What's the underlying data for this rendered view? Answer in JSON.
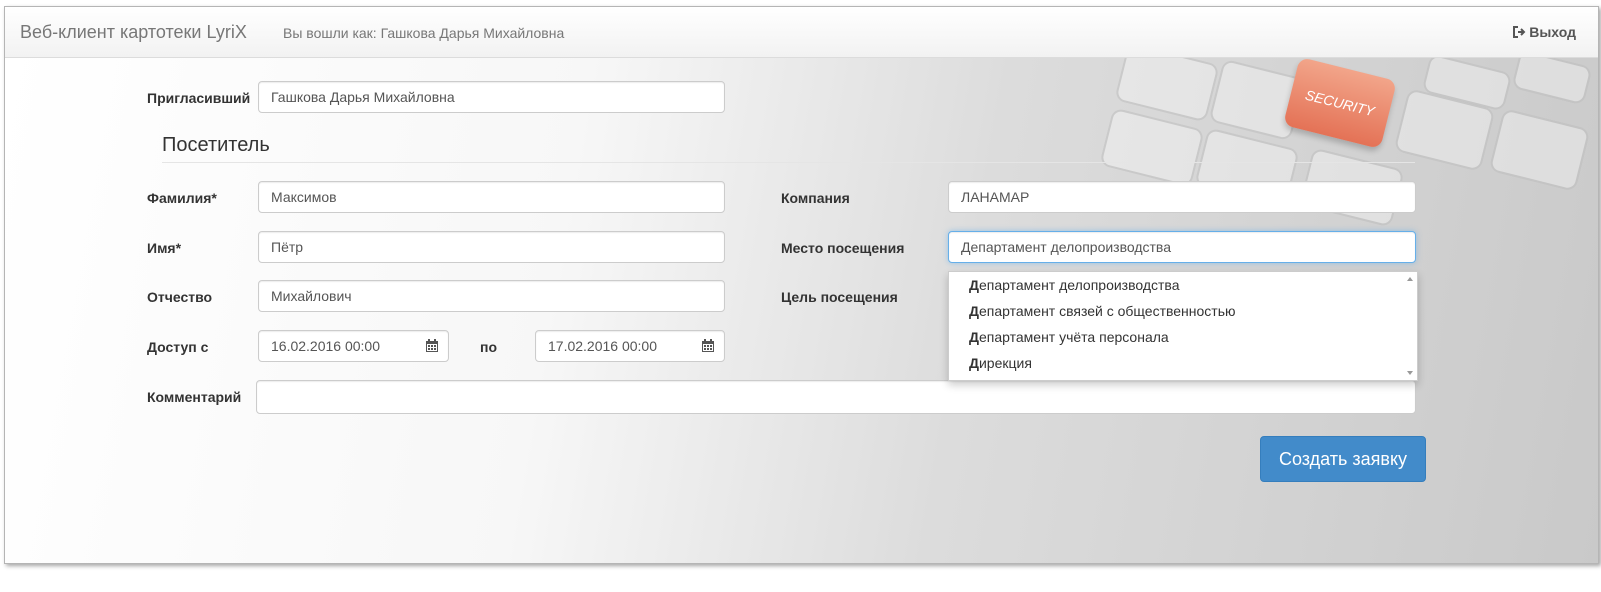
{
  "header": {
    "brand": "Веб-клиент картотеки LyriX",
    "user_info": "Вы вошли как: Гашкова Дарья Михайловна",
    "logout_label": "Выход"
  },
  "form": {
    "inviter_label": "Пригласивший",
    "inviter_value": "Гашкова Дарья Михайловна",
    "section_title": "Посетитель",
    "lastname_label": "Фамилия*",
    "lastname_value": "Максимов",
    "firstname_label": "Имя*",
    "firstname_value": "Пётр",
    "patronymic_label": "Отчество",
    "patronymic_value": "Михайлович",
    "access_from_label": "Доступ с",
    "access_from_value": "16.02.2016 00:00",
    "access_to_label": "по",
    "access_to_value": "17.02.2016 00:00",
    "comment_label": "Комментарий",
    "comment_value": "",
    "company_label": "Компания",
    "company_value": "ЛАНАМАР",
    "place_label": "Место посещения",
    "place_value": "Департамент делопроизводства",
    "purpose_label": "Цель посещения",
    "submit_label": "Создать заявку"
  },
  "dropdown": {
    "items": [
      {
        "bold": "Д",
        "rest": "епартамент делопроизводства"
      },
      {
        "bold": "Д",
        "rest": "епартамент связей с общественностью"
      },
      {
        "bold": "Д",
        "rest": "епартамент учёта персонала"
      },
      {
        "bold": "Д",
        "rest": "ирекция"
      }
    ]
  },
  "background": {
    "key_label": "SECURITY"
  },
  "colors": {
    "primary": "#428bca",
    "focus_border": "#66afe9",
    "security_key": "#e47256"
  }
}
